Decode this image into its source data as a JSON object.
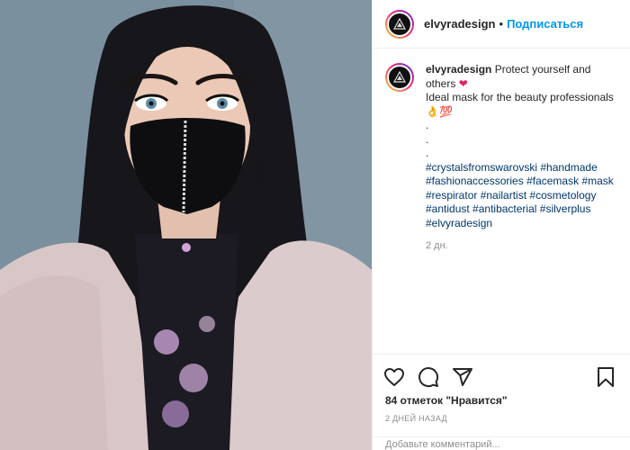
{
  "post": {
    "username": "elvyradesign",
    "separator": "•",
    "follow_label": "Подписаться"
  },
  "caption": {
    "username": "elvyradesign",
    "line1": "Protect yourself and others",
    "heart": "❤",
    "line2": "Ideal mask for the beauty professionals",
    "emoji": "👌💯",
    "dots": [
      ".",
      ".",
      "."
    ],
    "hashtags": [
      "#crystalsfromswarovski",
      "#handmade",
      "#fashionaccessories",
      "#facemask",
      "#mask",
      "#respirator",
      "#nailartist",
      "#cosmetology",
      "#antidust",
      "#antibacterial",
      "#silverplus",
      "#elvyradesign"
    ],
    "time": "2 дн."
  },
  "actions": {
    "icons": [
      "heart-icon",
      "comment-icon",
      "share-icon",
      "bookmark-icon"
    ]
  },
  "likes": "84 отметок \"Нравится\"",
  "date": "2 ДНЕЙ НАЗАД",
  "comment_placeholder": "Добавьте комментарий...",
  "colors": {
    "accent": "#0095f6",
    "text": "#262626",
    "muted": "#8e8e8e",
    "hashtag": "#00376b",
    "heart": "#e0245e"
  }
}
